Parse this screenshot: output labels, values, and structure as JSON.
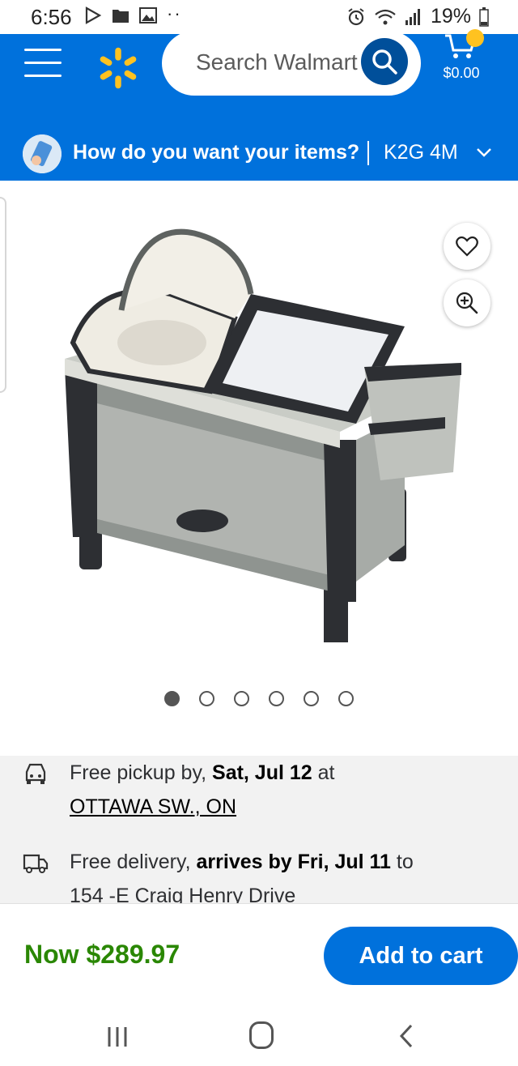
{
  "status_bar": {
    "time": "6:56",
    "battery": "19%"
  },
  "header": {
    "search_placeholder": "Search Walmart",
    "cart_total": "$0.00",
    "fulfillment_prompt": "How do you want your items?",
    "postal_code": "K2G 4M"
  },
  "gallery": {
    "image_count": 6,
    "active_index": 0
  },
  "pickup": {
    "prefix": "Free pickup by, ",
    "date": "Sat, Jul 12",
    "suffix": " at",
    "store": "OTTAWA SW., ON"
  },
  "delivery": {
    "prefix": "Free delivery, ",
    "date": "arrives by Fri, Jul 11",
    "suffix": " to",
    "address": "154 -E Craig Henry Drive"
  },
  "purchase": {
    "price": "Now $289.97",
    "add_to_cart": "Add to cart"
  },
  "colors": {
    "brand_blue": "#0071dc",
    "spark_yellow": "#ffc220",
    "price_green": "#2a8703"
  }
}
